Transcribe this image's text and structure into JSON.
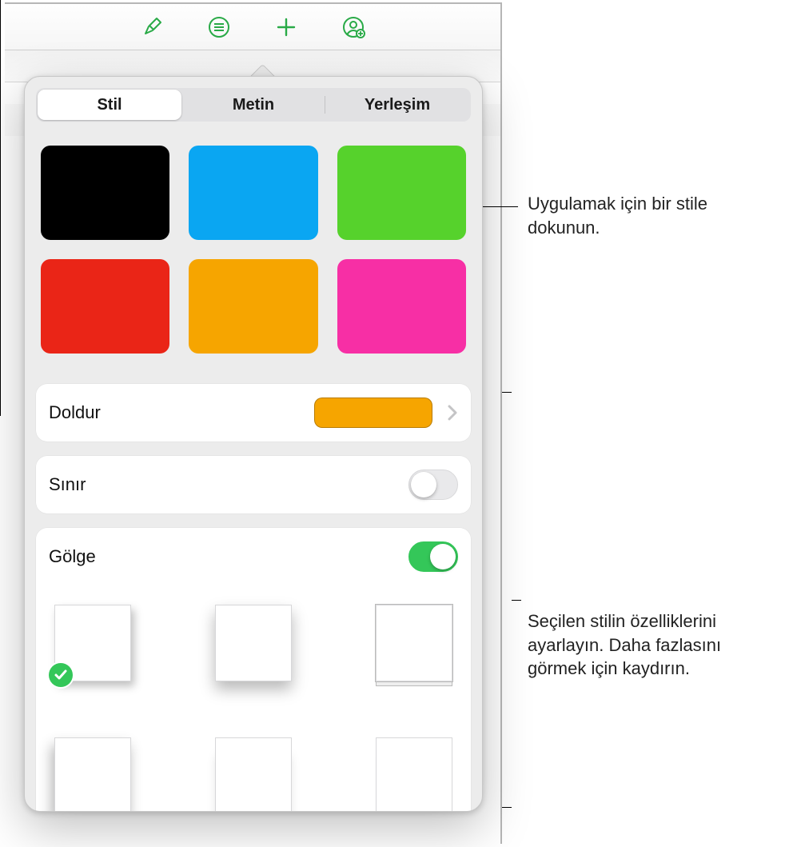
{
  "accent": "#29aa47",
  "toolbar": {
    "icons": [
      "brush-icon",
      "list-icon",
      "plus-icon",
      "share-person-icon"
    ]
  },
  "segmented": {
    "items": [
      "Stil",
      "Metin",
      "Yerleşim"
    ],
    "active_index": 0
  },
  "swatches": [
    "#000000",
    "#0aa6f2",
    "#56d22c",
    "#ea2517",
    "#f6a500",
    "#f72fa5"
  ],
  "rows": {
    "fill": {
      "label": "Doldur",
      "color": "#f6a500"
    },
    "border": {
      "label": "Sınır",
      "on": false
    },
    "shadow": {
      "label": "Gölge",
      "on": true,
      "selected_index": 0
    }
  },
  "callouts": {
    "tap_style": "Uygulamak için bir stile dokunun.",
    "adjust": "Seçilen stilin özelliklerini ayarlayın. Daha fazlasını görmek için kaydırın."
  }
}
